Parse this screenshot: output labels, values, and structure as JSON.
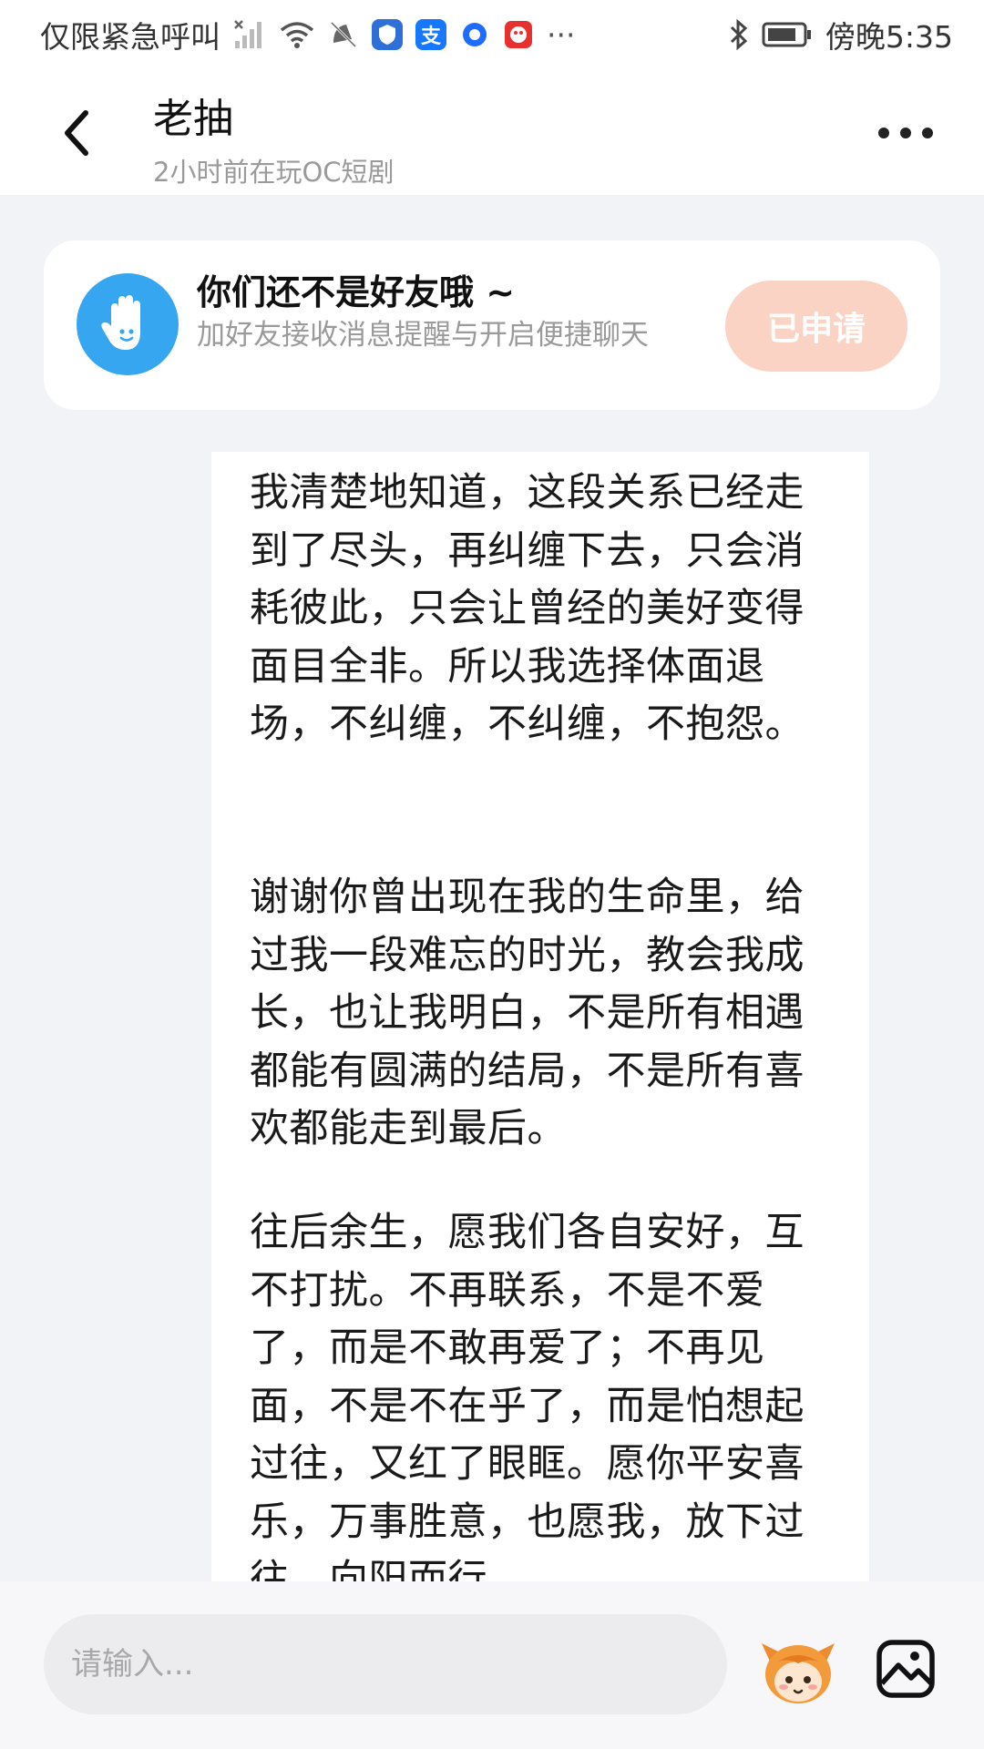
{
  "status_bar": {
    "carrier_text": "仅限紧急呼叫",
    "time_text": "傍晚5:35",
    "more_glyph": "···",
    "alipay_glyph": "支"
  },
  "header": {
    "title": "老抽",
    "subtitle": "2小时前在玩OC短剧"
  },
  "friend_card": {
    "title": "你们还不是好友哦 ~",
    "description": "加好友接收消息提醒与开启便捷聊天",
    "button_label": "已申请"
  },
  "message": {
    "paragraphs": [
      "我清楚地知道，这段关系已经走到了尽头，再纠缠下去，只会消耗彼此，只会让曾经的美好变得面目全非。所以我选择体面退场，不纠缠，不纠缠，不抱怨。",
      "谢谢你曾出现在我的生命里，给过我一段难忘的时光，教会我成长，也让我明白，不是所有相遇都能有圆满的结局，不是所有喜欢都能走到最后。",
      "往后余生，愿我们各自安好，互不打扰。不再联系，不是不爱了，而是不敢再爱了；不再见面，不是不在乎了，而是怕想起过往，又红了眼眶。愿你平安喜乐，万事胜意，也愿我，放下过往，向阳而行。"
    ]
  },
  "input": {
    "placeholder": "请输入..."
  },
  "icons": {
    "back": "chevron-left-icon",
    "more": "more-dots-icon",
    "hand": "hand-wave-icon",
    "emoji": "mascot-emoji-icon",
    "image": "image-icon"
  },
  "colors": {
    "accent_blue": "#36a6f0",
    "applied_button_bg": "#fbd3c4",
    "page_bg": "#f2f3f7"
  }
}
